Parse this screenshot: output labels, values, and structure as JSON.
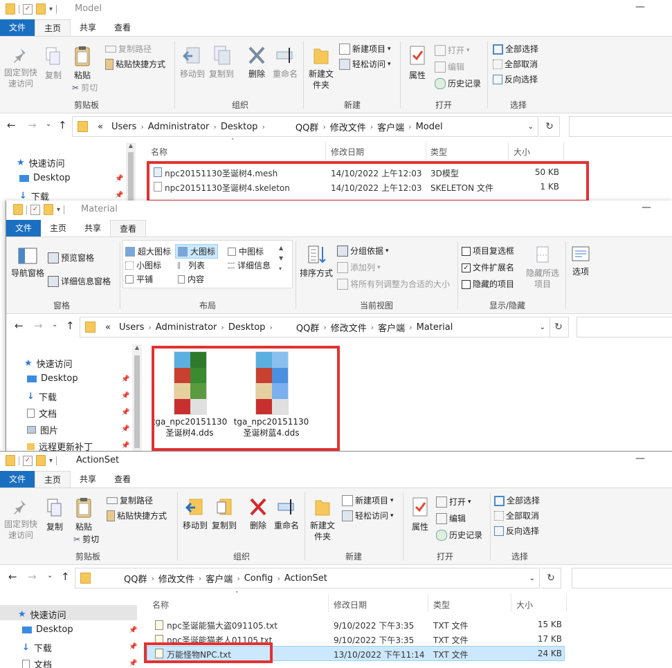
{
  "colors": {
    "accent": "#1a6fc1",
    "highlight": "#e23232",
    "selection": "#cce8ff"
  },
  "w1": {
    "title": "Model",
    "tabs": [
      "文件",
      "主页",
      "共享",
      "查看"
    ],
    "ribbon": {
      "pin": "固定到快速访问",
      "copy": "复制",
      "paste": "粘贴",
      "copy_path": "复制路径",
      "paste_shortcut": "粘贴快捷方式",
      "cut": "剪切",
      "g_clipboard": "剪贴板",
      "move_to": "移动到",
      "copy_to": "复制到",
      "delete": "删除",
      "rename": "重命名",
      "g_organize": "组织",
      "new_folder": "新建文件夹",
      "new_item": "新建项目",
      "easy_access": "轻松访问",
      "g_new": "新建",
      "properties": "属性",
      "open": "打开",
      "edit": "编辑",
      "history": "历史记录",
      "g_open": "打开",
      "select_all": "全部选择",
      "select_none": "全部取消",
      "invert": "反向选择",
      "g_select": "选择"
    },
    "crumbs": [
      "«",
      "Users",
      "Administrator",
      "Desktop",
      "QQ群",
      "修改文件",
      "客户端",
      "Model"
    ],
    "nav": [
      "快速访问",
      "Desktop",
      "下载"
    ],
    "columns": [
      "名称",
      "修改日期",
      "类型",
      "大小"
    ],
    "files": [
      {
        "name": "npc20151130圣诞树4.mesh",
        "date": "14/10/2022 上午12:03",
        "type": "3D模型",
        "size": "50 KB"
      },
      {
        "name": "npc20151130圣诞树4.skeleton",
        "date": "14/10/2022 上午12:03",
        "type": "SKELETON 文件",
        "size": "1 KB"
      }
    ]
  },
  "w2": {
    "title": "Material",
    "tabs": [
      "文件",
      "主页",
      "共享",
      "查看"
    ],
    "ribbon": {
      "nav_pane": "导航窗格",
      "preview": "预览窗格",
      "details": "详细信息窗格",
      "g_pane": "窗格",
      "xl_icons": "超大图标",
      "l_icons": "大图标",
      "m_icons": "中图标",
      "s_icons": "小图标",
      "list": "列表",
      "details_view": "详细信息",
      "tiles": "平铺",
      "content": "内容",
      "g_layout": "布局",
      "sort": "排序方式",
      "group_by": "分组依据",
      "add_col": "添加列",
      "fit_cols": "将所有列调整为合适的大小",
      "g_view": "当前视图",
      "item_chk": "项目复选框",
      "ext": "文件扩展名",
      "hidden": "隐藏的项目",
      "hide_sel": "隐藏所选项目",
      "g_showhide": "显示/隐藏",
      "options": "选项"
    },
    "crumbs": [
      "«",
      "Users",
      "Administrator",
      "Desktop",
      "QQ群",
      "修改文件",
      "客户端",
      "Material"
    ],
    "nav": [
      "快速访问",
      "Desktop",
      "下载",
      "文档",
      "图片",
      "远程更新补丁"
    ],
    "files": [
      {
        "name": "tga_npc20151130圣诞树4.dds"
      },
      {
        "name": "tga_npc20151130圣诞树蓝4.dds"
      }
    ]
  },
  "w3": {
    "title": "ActionSet",
    "tabs": [
      "文件",
      "主页",
      "共享",
      "查看"
    ],
    "ribbon": {
      "pin": "固定到快速访问",
      "copy": "复制",
      "paste": "粘贴",
      "copy_path": "复制路径",
      "paste_shortcut": "粘贴快捷方式",
      "cut": "剪切",
      "g_clipboard": "剪贴板",
      "move_to": "移动到",
      "copy_to": "复制到",
      "delete": "删除",
      "rename": "重命名",
      "g_organize": "组织",
      "new_folder": "新建文件夹",
      "new_item": "新建项目",
      "easy_access": "轻松访问",
      "g_new": "新建",
      "properties": "属性",
      "open": "打开",
      "edit": "编辑",
      "history": "历史记录",
      "g_open": "打开",
      "select_all": "全部选择",
      "select_none": "全部取消",
      "invert": "反向选择",
      "g_select": "选择"
    },
    "crumbs": [
      "QQ群",
      "修改文件",
      "客户端",
      "Config",
      "ActionSet"
    ],
    "nav": [
      "快速访问",
      "Desktop",
      "下载",
      "文档"
    ],
    "columns": [
      "名称",
      "修改日期",
      "类型",
      "大小"
    ],
    "files": [
      {
        "name": "npc圣诞能猫大盗091105.txt",
        "date": "9/10/2022 下午3:35",
        "type": "TXT 文件",
        "size": "15 KB"
      },
      {
        "name": "npc圣诞能猫老人01105.txt",
        "date": "9/10/2022 下午3:35",
        "type": "TXT 文件",
        "size": "17 KB"
      },
      {
        "name": "万能怪物NPC.txt",
        "date": "13/10/2022 下午11:14",
        "type": "TXT 文件",
        "size": "24 KB"
      }
    ]
  }
}
